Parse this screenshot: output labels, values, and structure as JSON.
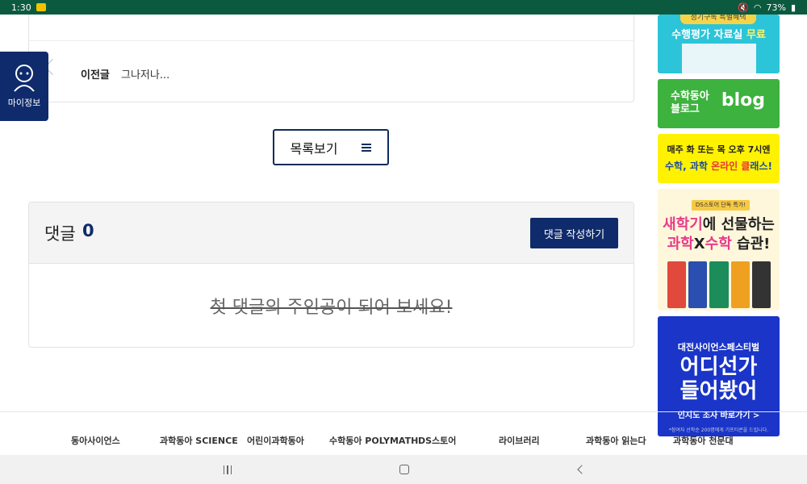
{
  "statusbar": {
    "time": "1:30",
    "battery": "73%"
  },
  "myinfo": {
    "label": "마이정보"
  },
  "prev_post": {
    "label": "이전글",
    "title": "그나저나..."
  },
  "list_button": {
    "label": "목록보기"
  },
  "comments": {
    "label": "댓글",
    "count": "0",
    "write_label": "댓글 작성하기",
    "empty_message": "첫 댓글의 주인공이 되어 보세요!"
  },
  "banners": {
    "b1": {
      "tag": "정기구독 특별혜택",
      "text": "수행평가 자료실 ",
      "em": "무료"
    },
    "b2": {
      "line1": "수학동아",
      "line2": "블로그",
      "logo": "blog"
    },
    "b3": {
      "line1": "매주 화 또는 목 오후 7시엔",
      "line2a": "수학, 과학 ",
      "line2em": "온라인 클",
      "line2b": "래스!"
    },
    "b4": {
      "tag": "DS스토어 단독 특가!",
      "line1a": "새학기",
      "line1b": "에 선물하는",
      "line2a": "과학",
      "line2b": "X",
      "line2c": "수학",
      "line2d": " 습관!"
    },
    "b5": {
      "line1": "대전사이언스페스티벌",
      "line2a": "어디선가",
      "line2b": "들어봤어",
      "line3": "인지도 조사 바로가기 >",
      "line4": "*참여자 선착순 200명에게 기프티콘을 드립니다."
    }
  },
  "footer": {
    "logos": [
      "동아사이언스",
      "과학동아 SCIENCE",
      "어린이과학동아",
      "수학동아 POLYMATH",
      "DS스토어",
      "라이브러리",
      "과학동아 읽는다",
      "과학동아 천문대"
    ]
  },
  "colors": {
    "navy": "#0f2b6b",
    "statusbar": "#0b5a3f"
  }
}
